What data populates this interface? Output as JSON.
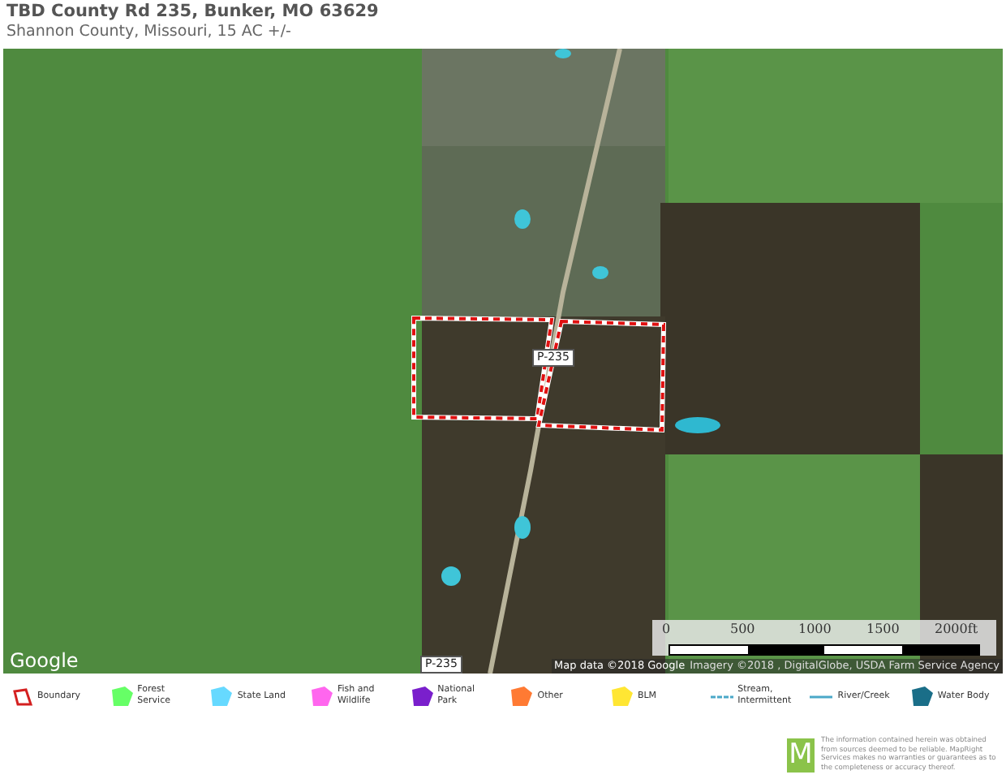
{
  "header": {
    "title": "TBD County Rd 235, Bunker, MO 63629",
    "subtitle": "Shannon County, Missouri, 15 AC +/-"
  },
  "map": {
    "road_labels": [
      "P-235",
      "P-235"
    ],
    "attribution": "Map data ©2018 Google",
    "imagery": "Imagery ©2018 , DigitalGlobe, USDA Farm Service Agency",
    "logo": "Google",
    "scale": {
      "ticks": [
        "0",
        "500",
        "1000",
        "1500",
        "2000ft"
      ]
    }
  },
  "legend": [
    {
      "label": "Boundary",
      "kind": "outline",
      "color": "#d42020"
    },
    {
      "label": "Forest Service",
      "kind": "polygon",
      "color": "#66ff66"
    },
    {
      "label": "State Land",
      "kind": "polygon",
      "color": "#66d9ff"
    },
    {
      "label": "Fish and Wildlife",
      "kind": "polygon",
      "color": "#ff66ee"
    },
    {
      "label": "National Park",
      "kind": "polygon",
      "color": "#7a1fcc"
    },
    {
      "label": "Other",
      "kind": "polygon",
      "color": "#ff7a33"
    },
    {
      "label": "BLM",
      "kind": "polygon",
      "color": "#ffe633"
    },
    {
      "label": "Stream, Intermittent",
      "kind": "dashed",
      "color": "#4aa8c8"
    },
    {
      "label": "River/Creek",
      "kind": "line",
      "color": "#4aa8c8"
    },
    {
      "label": "Water Body",
      "kind": "polygon",
      "color": "#1a6e88"
    }
  ],
  "footer": {
    "logo": "M",
    "disclaimer": "The information contained herein was obtained from sources deemed to be reliable. MapRight Services makes no warranties or guarantees as to the completeness or accuracy thereof."
  }
}
